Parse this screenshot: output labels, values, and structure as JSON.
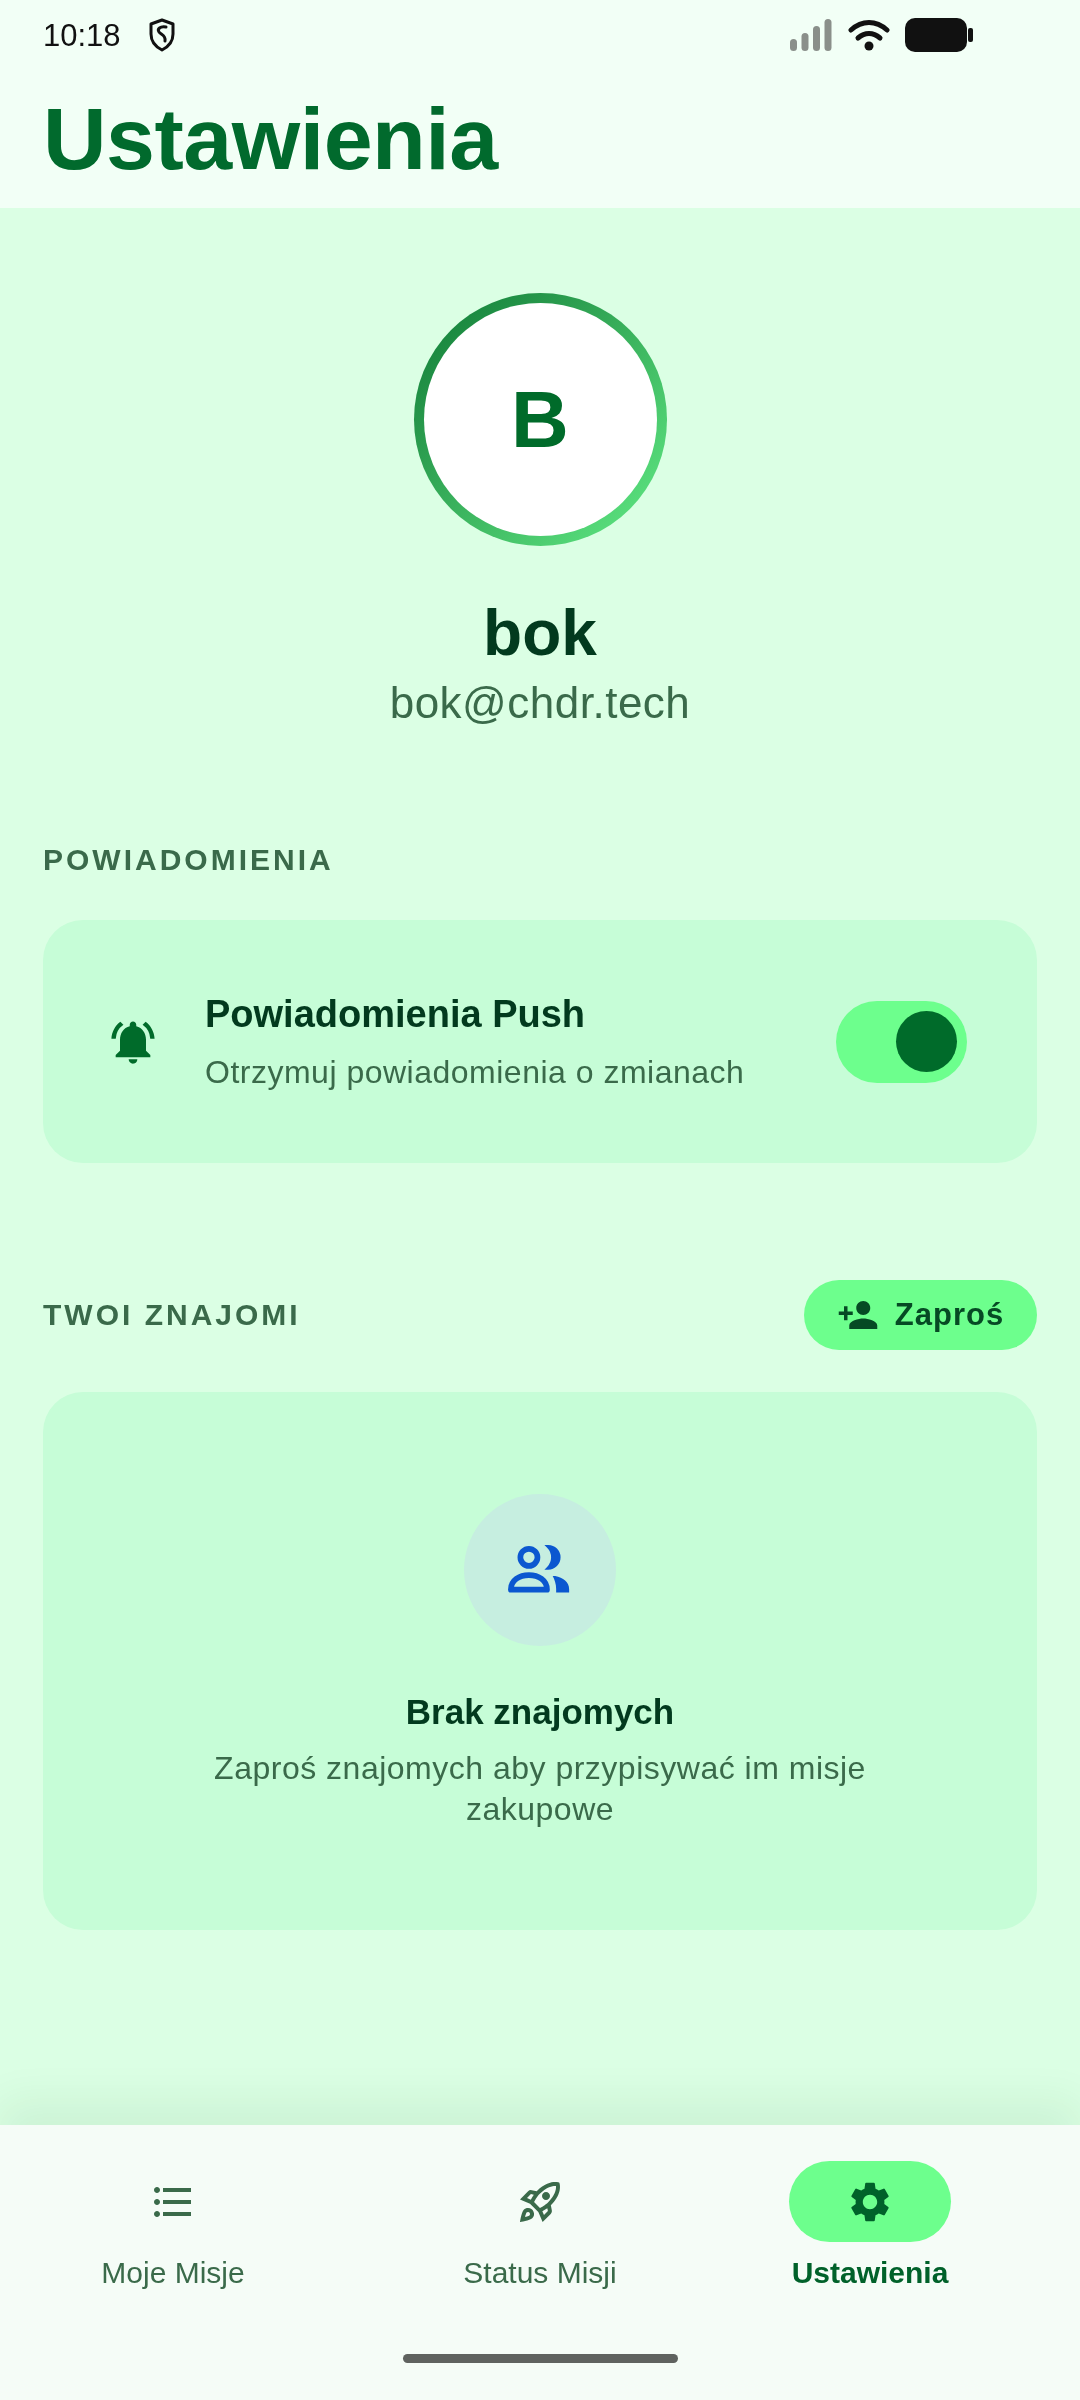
{
  "status_bar": {
    "time": "10:18"
  },
  "header": {
    "title": "Ustawienia"
  },
  "profile": {
    "initial": "B",
    "name": "bok",
    "email": "bok@chdr.tech"
  },
  "notifications": {
    "heading": "POWIADOMIENIA",
    "push": {
      "title": "Powiadomienia Push",
      "subtitle": "Otrzymuj powiadomienia o zmianach",
      "on": true
    }
  },
  "friends": {
    "heading": "TWOI ZNAJOMI",
    "invite_button": "Zaproś",
    "empty_state": {
      "title": "Brak znajomych",
      "message": "Zaproś znajomych aby przypisywać im misje zakupowe"
    }
  },
  "bottom_nav": [
    {
      "label": "Moje Misje",
      "selected": false
    },
    {
      "label": "Status Misji",
      "selected": false
    },
    {
      "label": "Ustawienia",
      "selected": true
    }
  ]
}
